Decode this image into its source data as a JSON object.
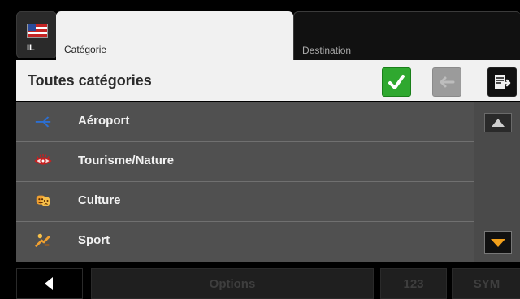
{
  "top": {
    "flag_code": "IL",
    "tabs": [
      {
        "label": "Catégorie",
        "active": true
      },
      {
        "label": "Destination",
        "active": false
      }
    ]
  },
  "header": {
    "title": "Toutes catégories",
    "buttons": {
      "ok": "check-icon",
      "back": "arrow-left-icon",
      "export": "export-icon"
    }
  },
  "list": {
    "items": [
      {
        "label": "Aéroport",
        "icon": "airplane-icon"
      },
      {
        "label": "Tourisme/Nature",
        "icon": "eye-icon"
      },
      {
        "label": "Culture",
        "icon": "theater-masks-icon"
      },
      {
        "label": "Sport",
        "icon": "sport-icon"
      }
    ]
  },
  "bottom": {
    "options_label": "Options",
    "numeric_label": "123",
    "symbols_label": "SYM"
  }
}
